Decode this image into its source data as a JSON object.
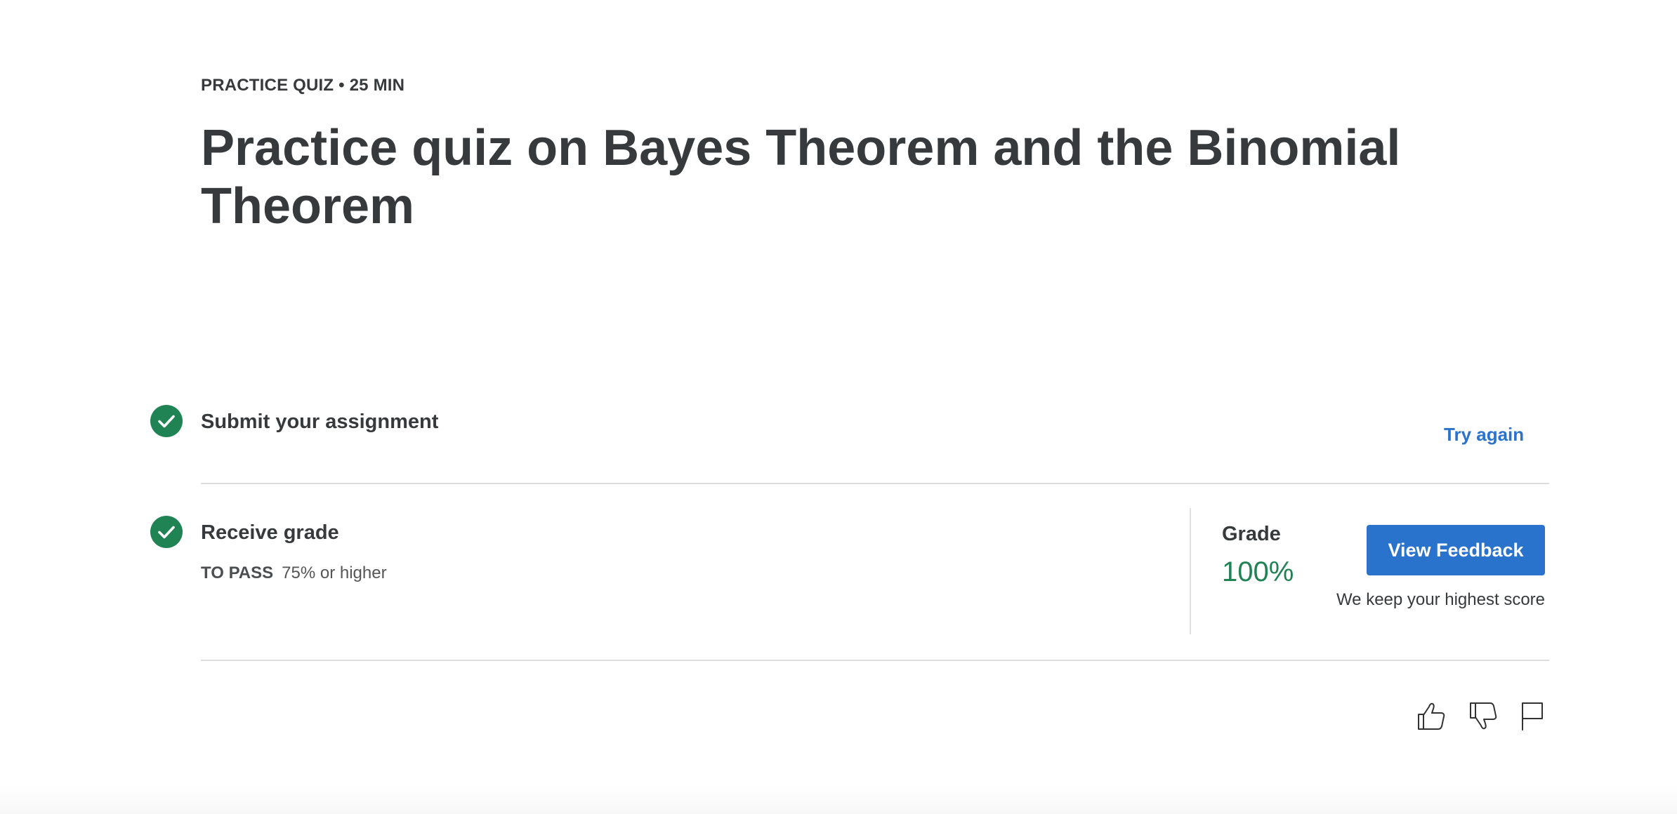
{
  "header": {
    "meta": "PRACTICE QUIZ • 25 MIN",
    "title": "Practice quiz on Bayes Theorem and the Binomial Theorem"
  },
  "steps": {
    "submit": {
      "icon": "check-circle-icon",
      "title": "Submit your assignment",
      "action_label": "Try again"
    },
    "receive": {
      "icon": "check-circle-icon",
      "title": "Receive grade",
      "pass_label": "TO PASS",
      "pass_value": "75% or higher"
    }
  },
  "grade": {
    "label": "Grade",
    "value": "100%",
    "button_label": "View Feedback",
    "note": "We keep your highest score"
  },
  "feedback_icons": [
    "thumbs-up-icon",
    "thumbs-down-icon",
    "flag-icon"
  ],
  "colors": {
    "success": "#1f8354",
    "accent": "#2a73cc",
    "text": "#373a3c"
  }
}
